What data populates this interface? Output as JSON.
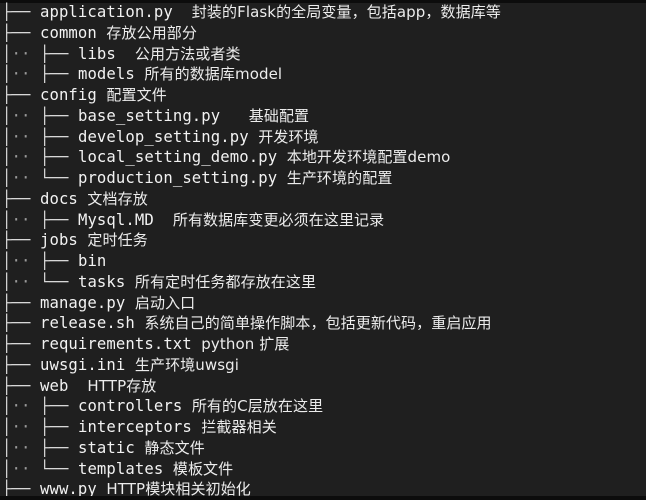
{
  "terminal": {
    "background": "#1f1f1f",
    "text_color": "#ececec",
    "rows": [
      {
        "depth": 0,
        "branch": "├──",
        "name": "application.py",
        "gap": "  ",
        "desc": "封装的Flask的全局变量，包括app，数据库等"
      },
      {
        "depth": 0,
        "branch": "├──",
        "name": "common",
        "gap": " ",
        "desc": "存放公用部分"
      },
      {
        "depth": 1,
        "branch": "├──",
        "name": "libs",
        "gap": "  ",
        "desc": "公用方法或者类"
      },
      {
        "depth": 1,
        "branch": "├──",
        "name": "models",
        "gap": " ",
        "desc": "所有的数据库model"
      },
      {
        "depth": 0,
        "branch": "├──",
        "name": "config",
        "gap": " ",
        "desc": "配置文件"
      },
      {
        "depth": 1,
        "branch": "├──",
        "name": "base_setting.py",
        "gap": "   ",
        "desc": "基础配置"
      },
      {
        "depth": 1,
        "branch": "├──",
        "name": "develop_setting.py",
        "gap": " ",
        "desc": "开发环境"
      },
      {
        "depth": 1,
        "branch": "├──",
        "name": "local_setting_demo.py",
        "gap": " ",
        "desc": "本地开发环境配置demo"
      },
      {
        "depth": 1,
        "branch": "└──",
        "name": "production_setting.py",
        "gap": " ",
        "desc": "生产环境的配置"
      },
      {
        "depth": 0,
        "branch": "├──",
        "name": "docs",
        "gap": " ",
        "desc": "文档存放"
      },
      {
        "depth": 1,
        "branch": "├──",
        "name": "Mysql.MD",
        "gap": "  ",
        "desc": "所有数据库变更必须在这里记录"
      },
      {
        "depth": 0,
        "branch": "├──",
        "name": "jobs",
        "gap": " ",
        "desc": "定时任务"
      },
      {
        "depth": 1,
        "branch": "├──",
        "name": "bin",
        "gap": "",
        "desc": ""
      },
      {
        "depth": 1,
        "branch": "└──",
        "name": "tasks",
        "gap": " ",
        "desc": "所有定时任务都存放在这里"
      },
      {
        "depth": 0,
        "branch": "├──",
        "name": "manage.py",
        "gap": " ",
        "desc": "启动入口"
      },
      {
        "depth": 0,
        "branch": "├──",
        "name": "release.sh",
        "gap": " ",
        "desc": "系统自己的简单操作脚本，包括更新代码，重启应用"
      },
      {
        "depth": 0,
        "branch": "├──",
        "name": "requirements.txt",
        "gap": " ",
        "desc": "python 扩展"
      },
      {
        "depth": 0,
        "branch": "├──",
        "name": "uwsgi.ini",
        "gap": " ",
        "desc": "生产环境uwsgi"
      },
      {
        "depth": 0,
        "branch": "├──",
        "name": "web",
        "gap": "  ",
        "desc": "HTTP存放"
      },
      {
        "depth": 1,
        "branch": "├──",
        "name": "controllers",
        "gap": " ",
        "desc": "所有的C层放在这里"
      },
      {
        "depth": 1,
        "branch": "├──",
        "name": "interceptors",
        "gap": " ",
        "desc": "拦截器相关"
      },
      {
        "depth": 1,
        "branch": "├──",
        "name": "static",
        "gap": " ",
        "desc": "静态文件"
      },
      {
        "depth": 1,
        "branch": "└──",
        "name": "templates",
        "gap": " ",
        "desc": "模板文件"
      },
      {
        "depth": 0,
        "branch": "├──",
        "name": "www.py",
        "gap": " ",
        "desc": "HTTP模块相关初始化"
      }
    ],
    "nested_prefix": {
      "bar": "│",
      "dots": "··"
    }
  }
}
